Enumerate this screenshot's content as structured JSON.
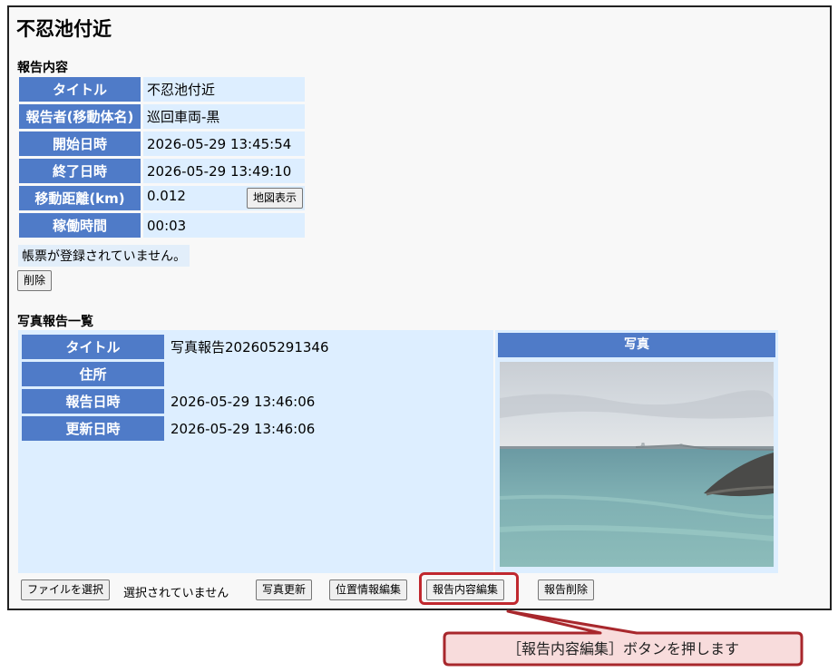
{
  "page_title": "不忍池付近",
  "report_section": {
    "title": "報告内容",
    "rows": [
      {
        "label": "タイトル",
        "value": "不忍池付近"
      },
      {
        "label": "報告者(移動体名)",
        "value": "巡回車両-黒"
      },
      {
        "label": "開始日時",
        "value": "2026-05-29 13:45:54"
      },
      {
        "label": "終了日時",
        "value": "2026-05-29 13:49:10"
      },
      {
        "label": "移動距離(km)",
        "value": "0.012"
      },
      {
        "label": "稼働時間",
        "value": "00:03"
      }
    ],
    "map_button": "地図表示",
    "form_note": "帳票が登録されていません。",
    "delete_button": "削除"
  },
  "photo_section": {
    "title": "写真報告一覧",
    "rows": [
      {
        "label": "タイトル",
        "value": "写真報告202605291346"
      },
      {
        "label": "住所",
        "value": ""
      },
      {
        "label": "報告日時",
        "value": "2026-05-29 13:46:06"
      },
      {
        "label": "更新日時",
        "value": "2026-05-29 13:46:06"
      }
    ],
    "photo_header": "写真"
  },
  "actions": {
    "file_select": "ファイルを選択",
    "file_status": "選択されていません",
    "photo_update": "写真更新",
    "location_edit": "位置情報編集",
    "report_edit": "報告内容編集",
    "report_delete": "報告削除"
  },
  "callout": {
    "text": "［報告内容編集］ボタンを押します"
  },
  "colors": {
    "header_blue": "#4f7bc8",
    "cell_bg": "#ddeeff",
    "highlight_red": "#c0282e",
    "callout_bg": "#f8dcdc"
  }
}
